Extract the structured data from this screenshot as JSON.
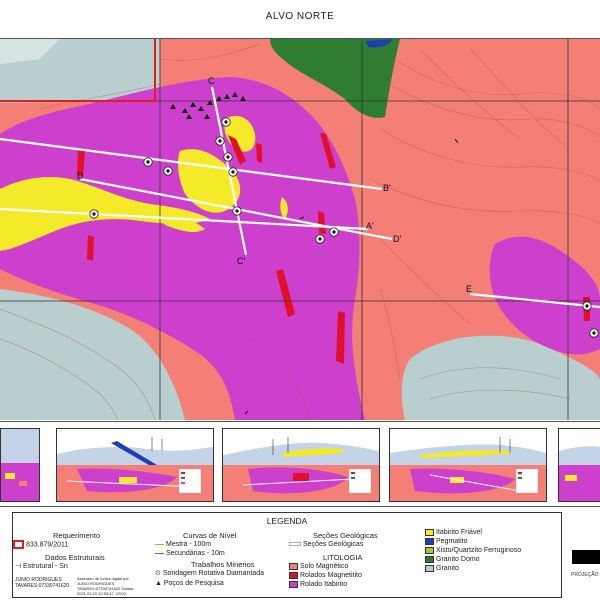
{
  "title": "ALVO NORTE",
  "legend": {
    "heading": "LEGENDA",
    "requerimento": {
      "title": "Requerimento",
      "item": "833.879/2011"
    },
    "dados": {
      "title": "Dados Estruturais",
      "item": "Estrutural - Sn"
    },
    "curvas": {
      "title": "Curvas de Nível",
      "mestra": "Mestra - 100m",
      "secundarias": "Secundárias - 10m"
    },
    "trabalhos": {
      "title": "Trabalhos Minerios",
      "sondagem": "Sondagem Rotativa Diamantada",
      "pocos": "Poços de Pesquisa"
    },
    "secoes": {
      "title": "Seções Geológicas",
      "item": "Seções Geológicas"
    },
    "litologia": {
      "title": "LITOLOGIA",
      "items": [
        "Solo Magnético",
        "Rolados Magnetitito",
        "Rolado Itabirito"
      ]
    },
    "litologia2": [
      "Itabirito Friável",
      "Pegmatito",
      "Xisto/Quartzito Ferruginoso",
      "Granito Domo",
      "Granito"
    ],
    "author": "JUNIO RODRIGUES\nTAVARES:07330741620",
    "signature": "Assinado de forma digital por JUNIO RODRIGUES TAVARES:07330741620 Dados: 2021.03.10 12:53:47 -03'00'"
  },
  "sections": {
    "labels": [
      "C",
      "C'",
      "D",
      "D'",
      "B'",
      "A'",
      "E"
    ]
  },
  "projection": "PROJEÇÃO",
  "colors": {
    "solo_magnetico": "#f47f76",
    "rolado_itabirito": "#cd3fcd",
    "itabirito_friavel": "#f5ea2a",
    "granito": "#b9cfcf",
    "granito_domo": "#2e7d32",
    "pegmatito": "#1f3fb0",
    "rolados_magnetitito": "#e0102a",
    "limite_requerimento": "#e11d1d"
  }
}
